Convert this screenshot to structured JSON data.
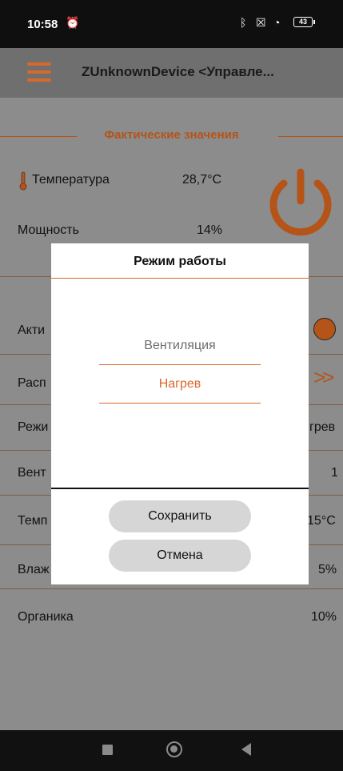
{
  "status": {
    "time": "10:58",
    "battery": "43"
  },
  "app": {
    "title": "ZUnknownDevice <Управле..."
  },
  "section": {
    "title": "Фактические значения"
  },
  "actual": {
    "temperature_label": "Температура",
    "temperature_value": "28,7°C",
    "power_label": "Мощность",
    "power_value": "14%"
  },
  "settings": [
    {
      "label": "Акти",
      "value": ""
    },
    {
      "label": "Расп",
      "value": ""
    },
    {
      "label": "Режи",
      "value": "грев"
    },
    {
      "label": "Вент",
      "value": "1"
    },
    {
      "label": "Темп",
      "value": "15°C"
    },
    {
      "label": "Влаж",
      "value": "5%"
    },
    {
      "label": "Органика",
      "value": "10%"
    }
  ],
  "dialog": {
    "title": "Режим работы",
    "options": [
      "Вентиляция",
      "Нагрев"
    ],
    "selected": "Нагрев",
    "save_label": "Сохранить",
    "cancel_label": "Отмена"
  },
  "colors": {
    "accent": "#d9692a",
    "dim_accent": "#b45418"
  }
}
